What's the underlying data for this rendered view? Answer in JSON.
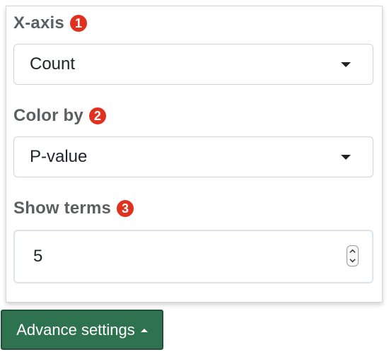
{
  "form": {
    "xaxis": {
      "label": "X-axis",
      "badge": "1",
      "selected": "Count"
    },
    "colorby": {
      "label": "Color by",
      "badge": "2",
      "selected": "P-value"
    },
    "showterms": {
      "label": "Show terms",
      "badge": "3",
      "value": "5"
    }
  },
  "advance_button": {
    "label": "Advance settings",
    "icon": "caret-up-icon"
  },
  "colors": {
    "badge": "#e0311e",
    "button_bg": "#2f7250",
    "label": "#5a5f62"
  }
}
